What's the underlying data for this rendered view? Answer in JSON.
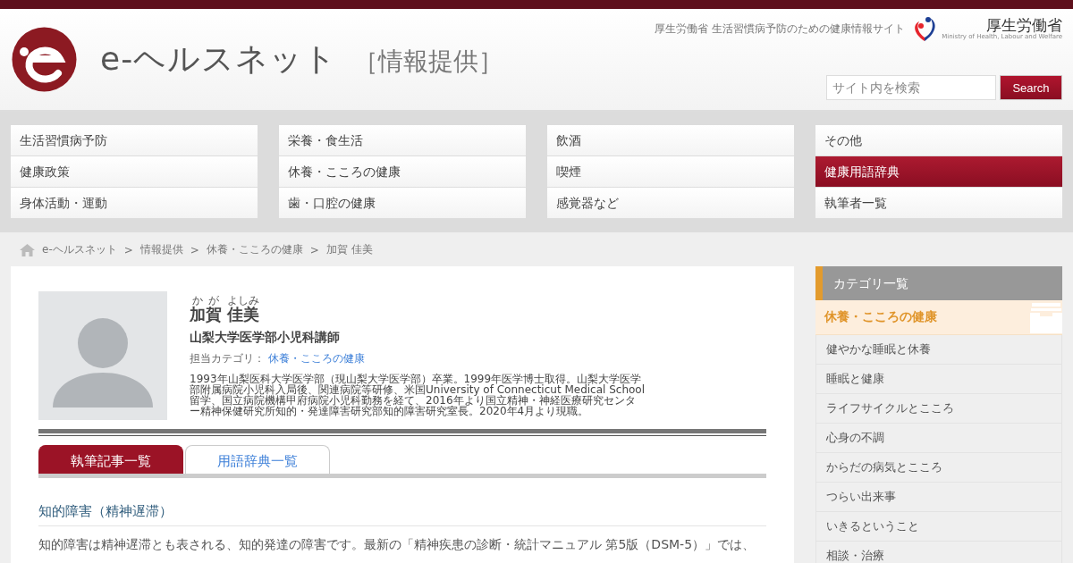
{
  "header": {
    "site_name": "e-ヘルスネット",
    "section": "［情報提供］",
    "tagline": "厚生労働省 生活習慣病予防のための健康情報サイト",
    "ministry_name": "厚生労働省",
    "ministry_name_en": "Ministry of Health, Labour and Welfare",
    "search": {
      "placeholder": "サイト内を検索",
      "button": "Search"
    }
  },
  "nav": [
    [
      {
        "label": "生活習慣病予防",
        "selected": false
      },
      {
        "label": "健康政策",
        "selected": false
      },
      {
        "label": "身体活動・運動",
        "selected": false
      }
    ],
    [
      {
        "label": "栄養・食生活",
        "selected": false
      },
      {
        "label": "休養・こころの健康",
        "selected": false
      },
      {
        "label": "歯・口腔の健康",
        "selected": false
      }
    ],
    [
      {
        "label": "飲酒",
        "selected": false
      },
      {
        "label": "喫煙",
        "selected": false
      },
      {
        "label": "感覚器など",
        "selected": false
      }
    ],
    [
      {
        "label": "その他",
        "selected": false
      },
      {
        "label": "健康用語辞典",
        "selected": true
      },
      {
        "label": "執筆者一覧",
        "selected": false
      }
    ]
  ],
  "breadcrumb": {
    "separator": ">",
    "items": [
      "e-ヘルスネット",
      "情報提供",
      "休養・こころの健康",
      "加賀 佳美"
    ]
  },
  "profile": {
    "name": [
      {
        "text": "加賀",
        "ruby": "かが"
      },
      {
        "text": "佳美",
        "ruby": "よしみ"
      }
    ],
    "affiliation": "山梨大学医学部小児科講師",
    "category_label": "担当カテゴリ：",
    "category": "休養・こころの健康",
    "bio": "1993年山梨医科大学医学部（現山梨大学医学部）卒業。1999年医学博士取得。山梨大学医学部附属病院小児科入局後、関連病院等研修、米国University of Connecticut Medical School留学、国立病院機構甲府病院小児科勤務を経て、2016年より国立精神・神経医療研究センター精神保健研究所知的・発達障害研究部知的障害研究室長。2020年4月より現職。"
  },
  "tabs": [
    {
      "label": "執筆記事一覧",
      "selected": true
    },
    {
      "label": "用語辞典一覧",
      "selected": false
    }
  ],
  "article": {
    "title": "知的障害（精神遅滞）",
    "text": "知的障害は精神遅滞とも表される、知的発達の障害です。最新の「精神疾患の診断・統計マニュアル 第5版（DSM-5）」では、"
  },
  "sidebar": {
    "title": "カテゴリ一覧",
    "current": "休養・こころの健康",
    "items": [
      "健やかな睡眠と休養",
      "睡眠と健康",
      "ライフサイクルとこころ",
      "心身の不調",
      "からだの病気とこころ",
      "つらい出来事",
      "いきるということ",
      "相談・治療"
    ]
  }
}
